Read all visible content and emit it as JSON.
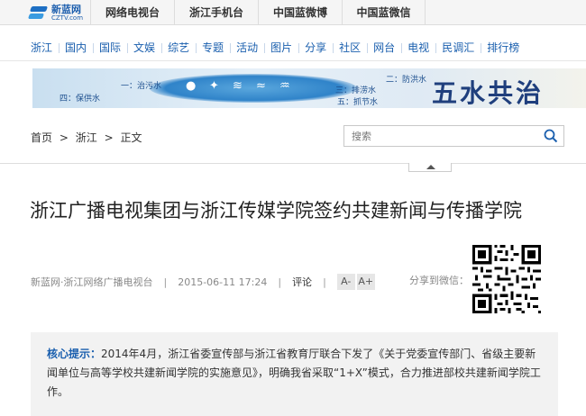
{
  "topbar": {
    "logo_cn": "新蓝网",
    "logo_en": "CZTV.com",
    "links": [
      "网络电视台",
      "浙江手机台",
      "中国蓝微博",
      "中国蓝微信"
    ]
  },
  "nav": {
    "items": [
      "浙江",
      "国内",
      "国际",
      "文娱",
      "综艺",
      "专题",
      "活动",
      "图片",
      "分享",
      "社区",
      "网台",
      "电视",
      "民调汇",
      "排行榜"
    ]
  },
  "banner": {
    "title": "五水共治",
    "labels": {
      "one": "一：治污水",
      "two": "二：防洪水",
      "three": "三：排涝水",
      "four": "四：保供水",
      "five": "五：抓节水"
    }
  },
  "breadcrumb": {
    "home": "首页",
    "section": "浙江",
    "current": "正文",
    "separator": ">"
  },
  "search": {
    "placeholder": "搜索"
  },
  "article": {
    "title": "浙江广播电视集团与浙江传媒学院签约共建新闻与传播学院",
    "source": "新蓝网·浙江网络广播电视台",
    "datetime": "2015-06-11 17:24",
    "comment_label": "评论",
    "font_smaller": "A-",
    "font_larger": "A+",
    "share_label": "分享到微信：",
    "summary_label": "核心提示：",
    "summary_text": "2014年4月，浙江省委宣传部与浙江省教育厅联合下发了《关于党委宣传部门、省级主要新闻单位与高等学校共建新闻学院的实施意见》，明确我省采取“1+X”模式，合力推进部校共建新闻学院工作。"
  },
  "colors": {
    "accent": "#1a5fae",
    "topbar_bg": "#f5f5f5",
    "summary_bg": "#f2f2f2"
  }
}
